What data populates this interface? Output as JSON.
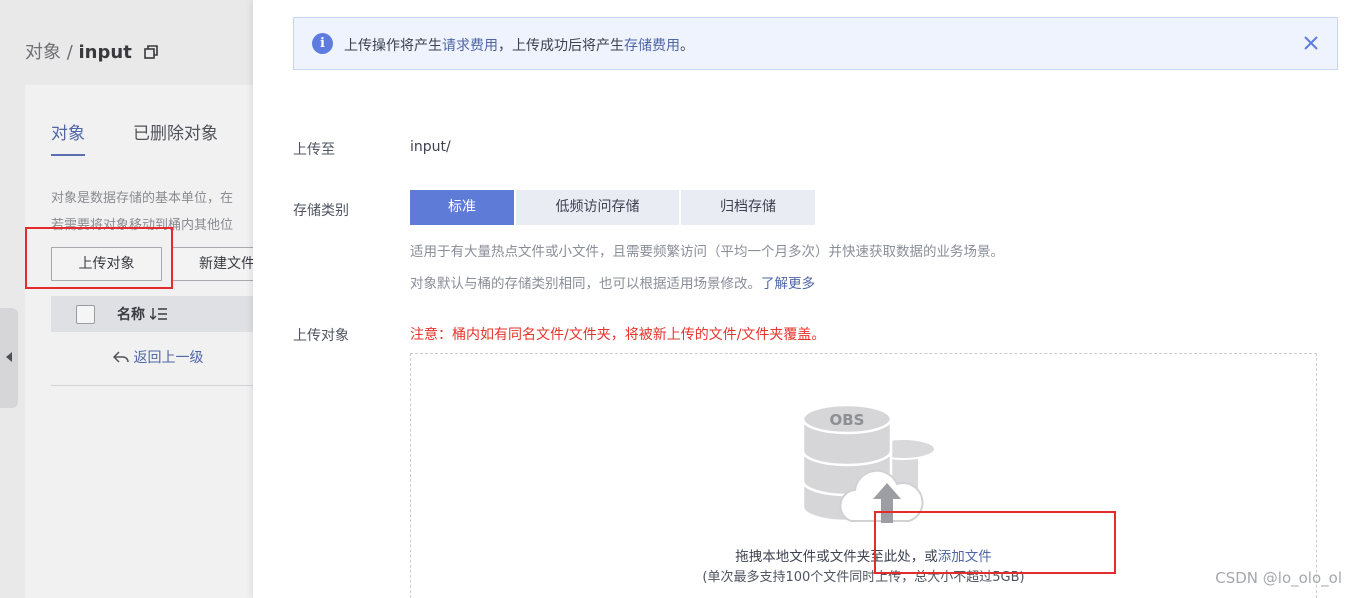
{
  "background_page": {
    "breadcrumb_parent": "对象",
    "breadcrumb_sep": " / ",
    "breadcrumb_current": "input",
    "tabs": [
      "对象",
      "已删除对象"
    ],
    "desc_line1": "对象是数据存储的基本单位，在",
    "desc_line2": "若需要将对象移动到桶内其他位",
    "upload_button": "上传对象",
    "new_folder_button": "新建文件",
    "column_name": "名称",
    "back_link": "返回上一级"
  },
  "notice": {
    "text_1": "上传操作将产生",
    "link_1": "请求费用",
    "text_2": "，上传成功后将产生",
    "link_2": "存储费用",
    "text_3": "。"
  },
  "form": {
    "upload_to_label": "上传至",
    "upload_to_value": "input/",
    "storage_class_label": "存储类别",
    "storage_classes": [
      "标准",
      "低频访问存储",
      "归档存储"
    ],
    "selected_storage_class": "标准",
    "help_line1": "适用于有大量热点文件或小文件，且需要频繁访问（平均一个月多次）并快速获取数据的业务场景。",
    "help_line2_text": "对象默认与桶的存储类别相同，也可以根据适用场景修改。",
    "help_line2_link": "了解更多",
    "upload_object_label": "上传对象",
    "warning": "注意：桶内如有同名文件/文件夹，将被新上传的文件/文件夹覆盖。",
    "drop_text": "拖拽本地文件或文件夹至此处，或",
    "drop_link": "添加文件",
    "drop_sub": "(单次最多支持100个文件同时上传，总大小不超过5GB)",
    "illustration_label": "OBS"
  },
  "watermark": "CSDN @lo_olo_ol",
  "colors": {
    "primary": "#5e7ce0",
    "link": "#5066a6",
    "warning": "#e5342c",
    "annotation_red": "#e52c2c"
  }
}
